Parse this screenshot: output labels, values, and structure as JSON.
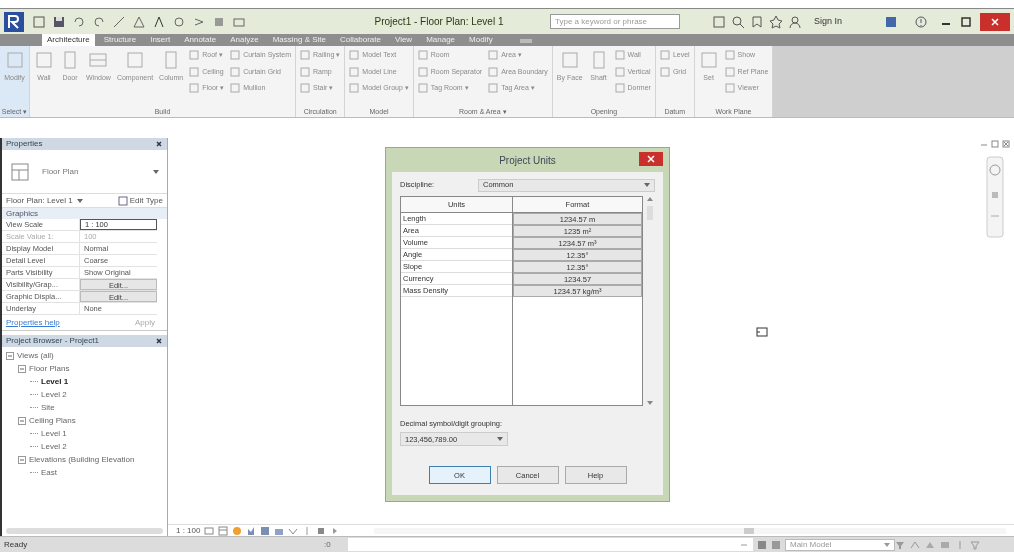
{
  "window": {
    "title": "Project1 - Floor Plan: Level 1",
    "search_placeholder": "Type a keyword or phrase",
    "sign_in": "Sign In"
  },
  "tabs": [
    {
      "label": "Architecture",
      "selected": true
    },
    {
      "label": "Structure",
      "selected": false
    },
    {
      "label": "Insert",
      "selected": false
    },
    {
      "label": "Annotate",
      "selected": false
    },
    {
      "label": "Analyze",
      "selected": false
    },
    {
      "label": "Massing & Site",
      "selected": false
    },
    {
      "label": "Collaborate",
      "selected": false
    },
    {
      "label": "View",
      "selected": false
    },
    {
      "label": "Manage",
      "selected": false
    },
    {
      "label": "Modify",
      "selected": false
    }
  ],
  "ribbon": [
    {
      "label": "Select ▾",
      "large": [
        "Modify"
      ]
    },
    {
      "label": "Build",
      "large": [
        "Wall",
        "Door",
        "Window",
        "Component",
        "Column"
      ],
      "columns": [
        [
          "Roof ▾",
          "Ceiling",
          "Floor ▾"
        ],
        [
          "Curtain System",
          "Curtain Grid",
          "Mullion"
        ]
      ]
    },
    {
      "label": "Circulation",
      "columns": [
        [
          "Railing ▾",
          "Ramp",
          "Stair ▾"
        ]
      ]
    },
    {
      "label": "Model",
      "columns": [
        [
          "Model Text",
          "Model Line",
          "Model Group ▾"
        ]
      ]
    },
    {
      "label": "Room & Area ▾",
      "columns": [
        [
          "Room",
          "Room Separator",
          "Tag Room ▾"
        ],
        [
          "Area ▾",
          "Area Boundary",
          "Tag Area ▾"
        ]
      ]
    },
    {
      "label": "Opening",
      "large": [
        "By Face",
        "Shaft"
      ],
      "columns": [
        [
          "Wall",
          "Vertical",
          "Dormer"
        ]
      ]
    },
    {
      "label": "Datum",
      "columns": [
        [
          "Level",
          "Grid"
        ]
      ]
    },
    {
      "label": "Work Plane",
      "large": [
        "Set"
      ],
      "columns": [
        [
          "Show",
          "Ref Plane",
          "Viewer"
        ]
      ]
    }
  ],
  "properties": {
    "title": "Properties",
    "type_name": "Floor Plan",
    "instance": "Floor Plan: Level 1",
    "edit_type": "Edit Type",
    "group": "Graphics",
    "rows": [
      {
        "name": "View Scale",
        "value": "1 : 100",
        "kind": "field",
        "disabled": false
      },
      {
        "name": "Scale Value  1:",
        "value": "100",
        "kind": "text",
        "disabled": true
      },
      {
        "name": "Display Model",
        "value": "Normal",
        "kind": "text",
        "disabled": false
      },
      {
        "name": "Detail Level",
        "value": "Coarse",
        "kind": "text",
        "disabled": false
      },
      {
        "name": "Parts Visibility",
        "value": "Show Original",
        "kind": "text",
        "disabled": false
      },
      {
        "name": "Visibility/Grap...",
        "value": "Edit...",
        "kind": "button",
        "disabled": false
      },
      {
        "name": "Graphic Displa...",
        "value": "Edit...",
        "kind": "button",
        "disabled": false
      },
      {
        "name": "Underlay",
        "value": "None",
        "kind": "text",
        "disabled": false
      }
    ],
    "help": "Properties help",
    "apply": "Apply"
  },
  "browser": {
    "title": "Project Browser - Project1",
    "tree": [
      {
        "label": "Views (all)",
        "expanded": true,
        "children": [
          {
            "label": "Floor Plans",
            "expanded": true,
            "children": [
              {
                "label": "Level 1",
                "selected": true
              },
              {
                "label": "Level 2",
                "selected": false
              },
              {
                "label": "Site",
                "selected": false
              }
            ]
          },
          {
            "label": "Ceiling Plans",
            "expanded": true,
            "children": [
              {
                "label": "Level 1",
                "selected": false
              },
              {
                "label": "Level 2",
                "selected": false
              }
            ]
          },
          {
            "label": "Elevations (Building Elevation",
            "expanded": true,
            "children": [
              {
                "label": "East",
                "selected": false
              }
            ]
          }
        ]
      }
    ]
  },
  "dialog": {
    "title": "Project Units",
    "discipline_label": "Discipline:",
    "discipline": "Common",
    "columns": [
      "Units",
      "Format"
    ],
    "rows": [
      {
        "unit": "Length",
        "format": "1234.57 m"
      },
      {
        "unit": "Area",
        "format": "1235 m²"
      },
      {
        "unit": "Volume",
        "format": "1234.57 m³"
      },
      {
        "unit": "Angle",
        "format": "12.35°"
      },
      {
        "unit": "Slope",
        "format": "12.35°"
      },
      {
        "unit": "Currency",
        "format": "1234.57"
      },
      {
        "unit": "Mass Density",
        "format": "1234.57 kg/m³"
      }
    ],
    "grouping_label": "Decimal symbol/digit grouping:",
    "grouping": "123,456,789.00",
    "buttons": [
      "OK",
      "Cancel",
      "Help"
    ]
  },
  "view_bar": {
    "scale": "1 : 100"
  },
  "status_bar": {
    "message": "Ready",
    "count": ":0",
    "model": "Main Model"
  }
}
